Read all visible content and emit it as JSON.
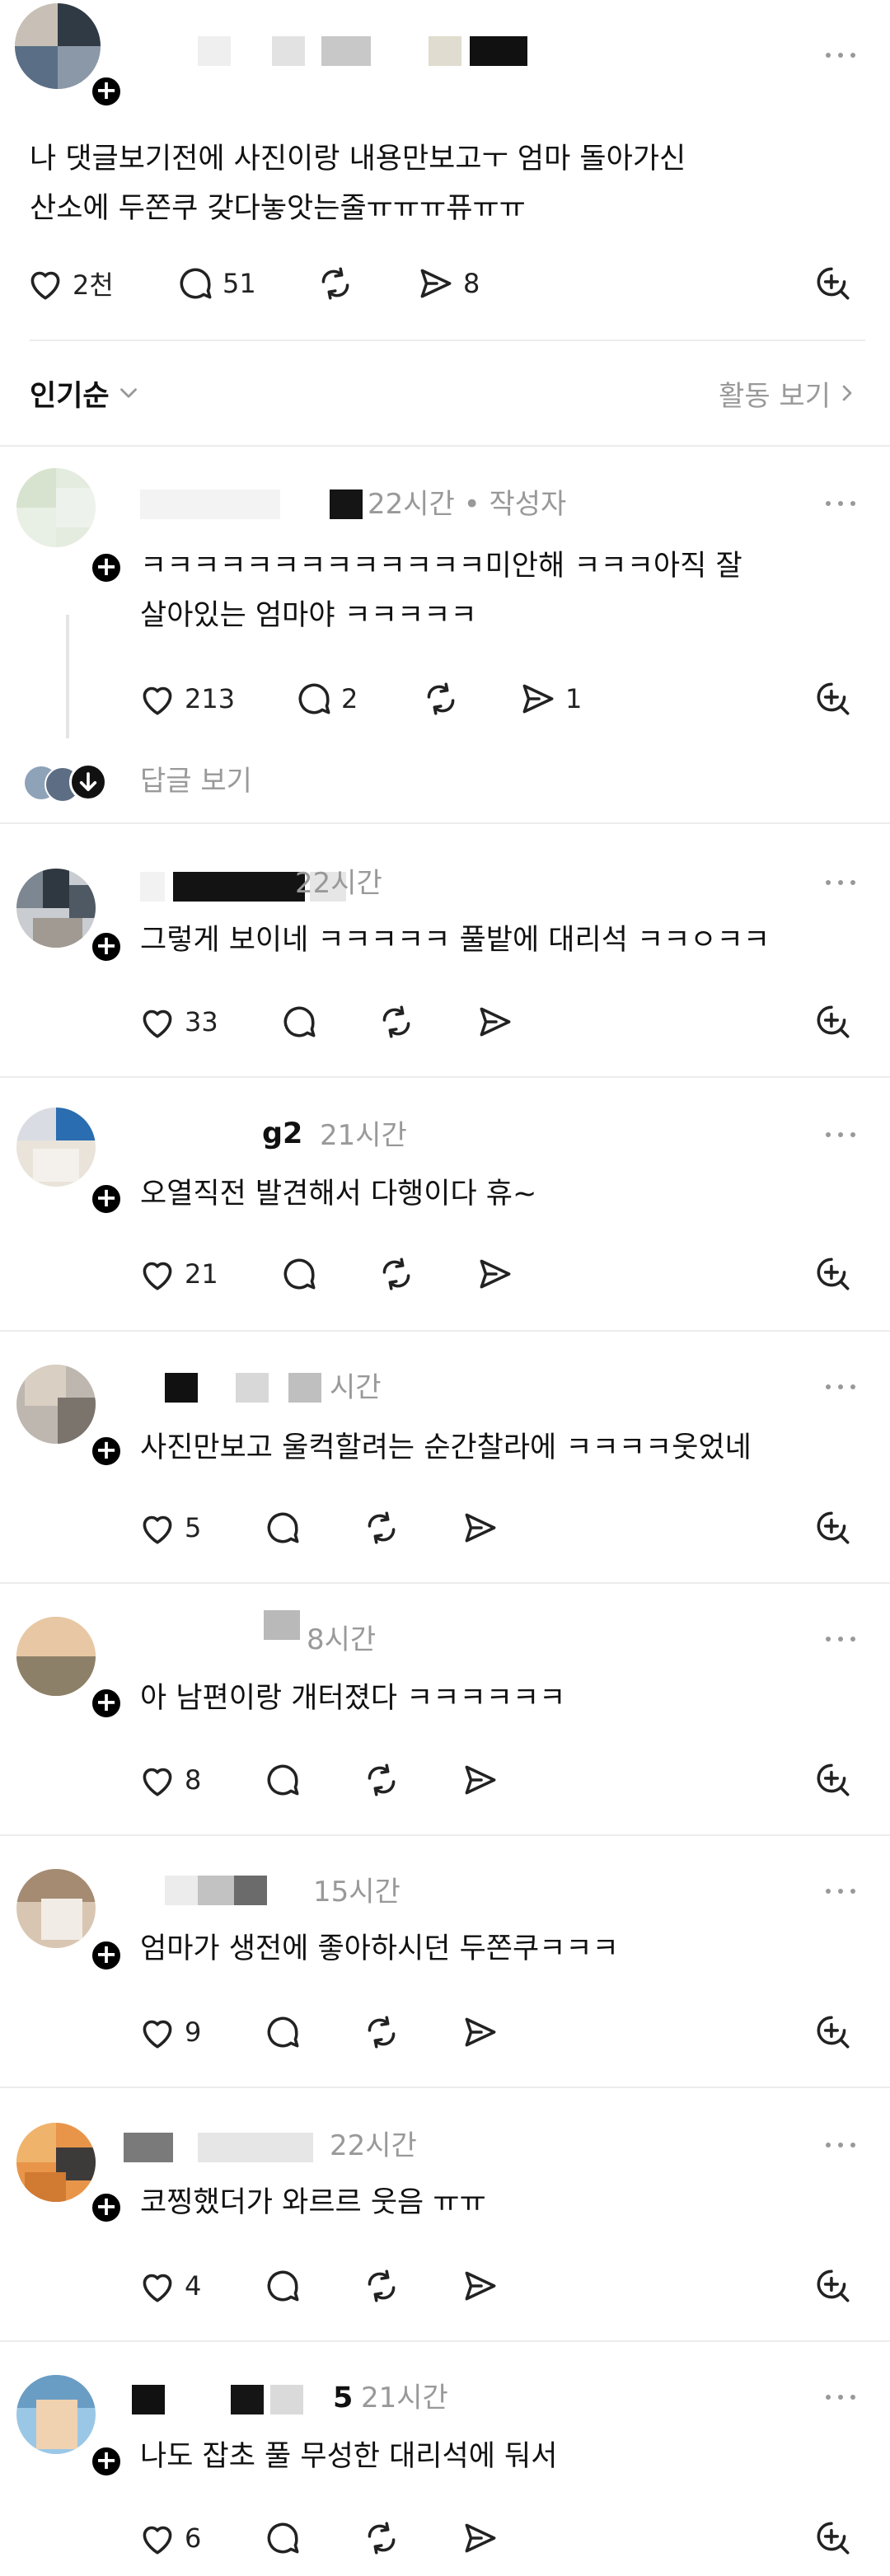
{
  "post": {
    "text_line1": "나 댓글보기전에  사진이랑 내용만보고ㅜ  엄마 돌아가신",
    "text_line2": "산소에  두쫀쿠 갖다놓앗는줄ㅠㅠㅠ퓨ㅠㅠ",
    "likes": "2천",
    "comments": "51",
    "shares": "8"
  },
  "sort": {
    "label": "인기순",
    "activity_label": "활동 보기"
  },
  "reply_link": "답글 보기",
  "comments": [
    {
      "name": "",
      "meta": "22시간 • 작성자",
      "line1": "ㅋㅋㅋㅋㅋㅋㅋㅋㅋㅋㅋㅋㅋ미안해 ㅋㅋㅋ아직 잘",
      "line2": "살아있는 엄마야 ㅋㅋㅋㅋㅋ",
      "likes": "213",
      "replies": "2",
      "shares": "1"
    },
    {
      "name": "",
      "meta": "22시간",
      "line1": "그렇게 보이네 ㅋㅋㅋㅋㅋ 풀밭에 대리석 ㅋㅋㅇㅋㅋ",
      "likes": "33"
    },
    {
      "name": "g2",
      "meta": "21시간",
      "line1": "오열직전 발견해서 다행이다 휴~",
      "likes": "21"
    },
    {
      "name": "",
      "meta": "시간",
      "line1": "사진만보고 울컥할려는 순간찰라에 ㅋㅋㅋㅋ웃었네",
      "likes": "5"
    },
    {
      "name": "",
      "meta": "8시간",
      "line1": "아 남편이랑 개터졌다 ㅋㅋㅋㅋㅋㅋ",
      "likes": "8"
    },
    {
      "name": "",
      "meta": "15시간",
      "line1": "엄마가 생전에 좋아하시던 두쫀쿠ㅋㅋㅋ",
      "likes": "9"
    },
    {
      "name": "",
      "meta": "22시간",
      "line1": "코찡했더가 와르르 웃음 ㅠㅠ",
      "likes": "4"
    },
    {
      "name": "5",
      "meta": "21시간",
      "line1": "나도 잡초 풀 무성한 대리석에 둬서",
      "likes": "6"
    }
  ],
  "colors": {
    "text": "#111111",
    "muted": "#999999",
    "divider": "#ececec",
    "badge": "#000000"
  },
  "icons": [
    "heart-icon",
    "comment-icon",
    "repost-icon",
    "send-icon",
    "add-icon",
    "more-icon",
    "chevron-down-icon",
    "chevron-right-icon",
    "plus-icon"
  ]
}
